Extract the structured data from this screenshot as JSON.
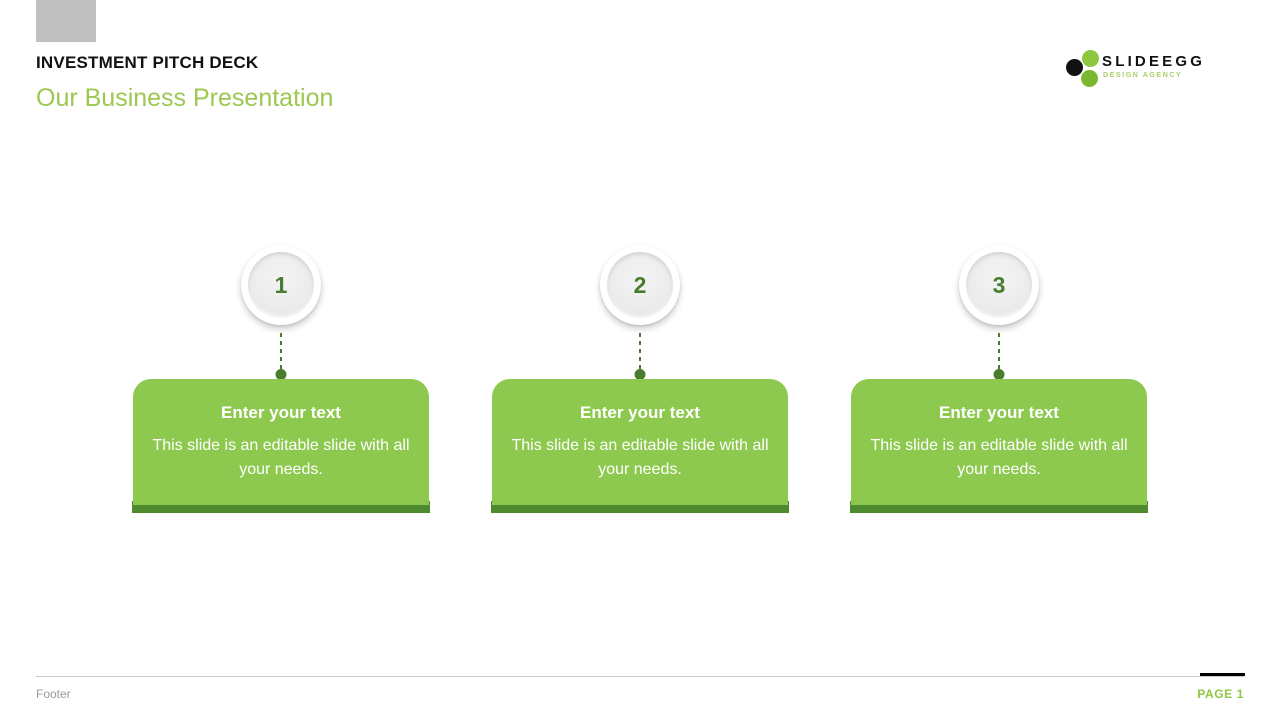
{
  "slide": {
    "eyebrow": "INVESTMENT PITCH DECK",
    "headline": "Our Business Presentation",
    "accent_color": "#8DC94E",
    "accent_dark_color": "#4F8A30",
    "headline_color": "#9DC751",
    "number_color": "#4A7C2F",
    "placeholder_color": "#c0c0c0"
  },
  "brand": {
    "name": "SLIDEEGG",
    "tagline": "DESIGN AGENCY",
    "dot_black": "#111111",
    "dot_green_top": "#8DC63F",
    "dot_green_bottom": "#7CB82F"
  },
  "columns": [
    {
      "number": "1",
      "title": "Enter your text",
      "body": "This slide is an editable slide with all your needs."
    },
    {
      "number": "2",
      "title": "Enter your text",
      "body": "This slide is an editable slide with all your needs."
    },
    {
      "number": "3",
      "title": "Enter your text",
      "body": "This slide is an editable slide with all your needs."
    }
  ],
  "footer": {
    "text": "Footer",
    "page_label": "PAGE 1",
    "page_color": "#8DC63F"
  }
}
